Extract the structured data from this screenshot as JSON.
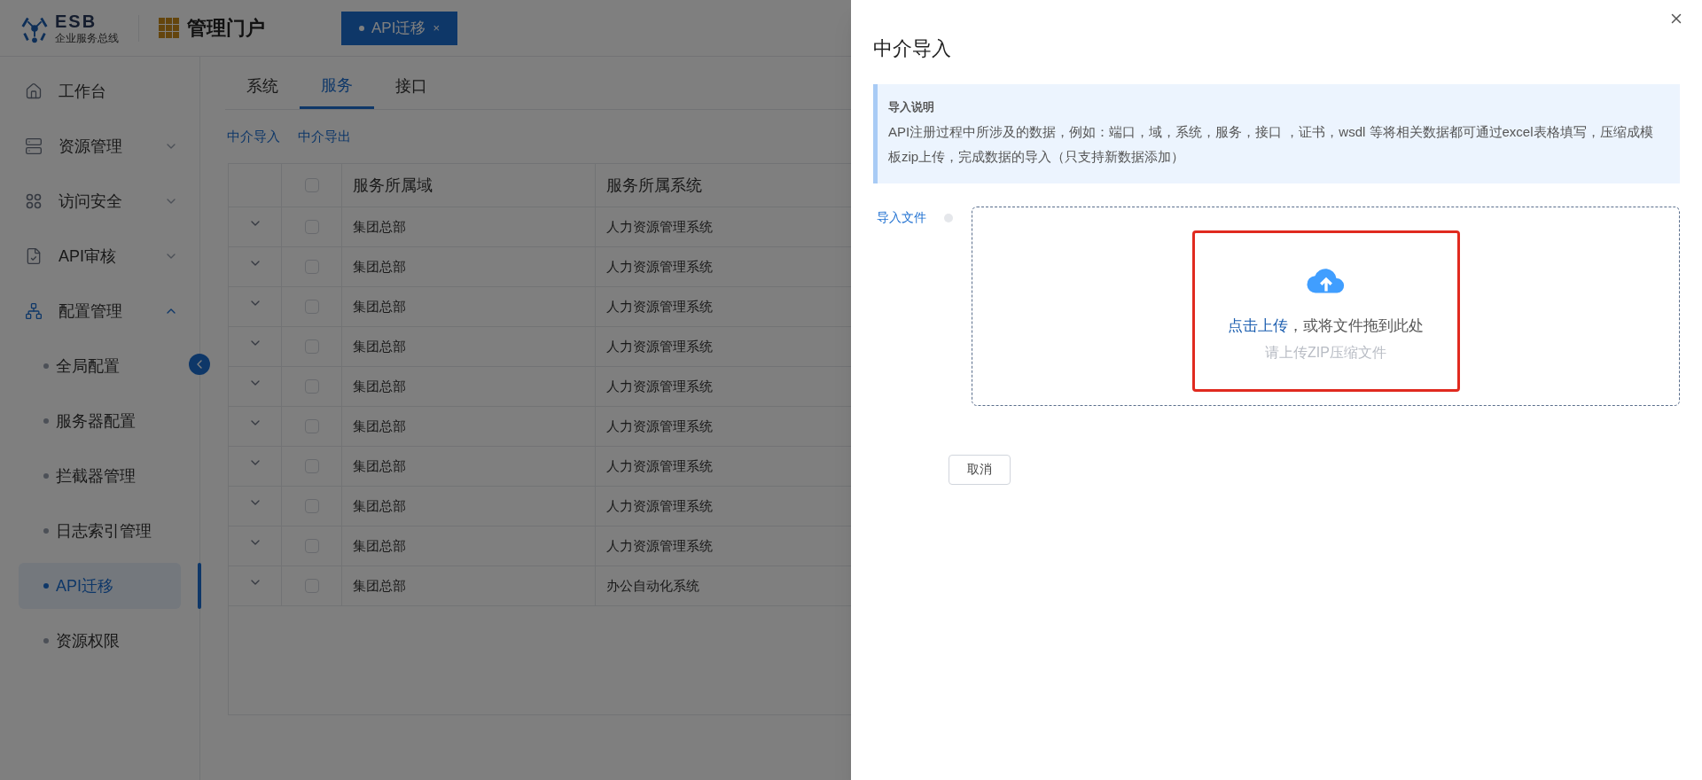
{
  "header": {
    "logo_title": "ESB",
    "logo_subtitle": "企业服务总线",
    "portal_title": "管理门户"
  },
  "open_tabs": [
    {
      "label": "API迁移",
      "close": "×",
      "selected": true
    }
  ],
  "sidebar": {
    "items": [
      {
        "label": "工作台",
        "selected": false
      },
      {
        "label": "资源管理",
        "expanded": false,
        "selected": false
      },
      {
        "label": "访问安全",
        "expanded": false,
        "selected": false
      },
      {
        "label": "API审核",
        "expanded": false,
        "selected": false
      },
      {
        "label": "配置管理",
        "expanded": true,
        "selected": false,
        "children": [
          {
            "label": "全局配置",
            "selected": false
          },
          {
            "label": "服务器配置",
            "selected": false
          },
          {
            "label": "拦截器管理",
            "selected": false
          },
          {
            "label": "日志索引管理",
            "selected": false
          },
          {
            "label": "API迁移",
            "selected": true
          },
          {
            "label": "资源权限",
            "selected": false
          }
        ]
      }
    ]
  },
  "tabs": [
    {
      "label": "系统",
      "selected": false
    },
    {
      "label": "服务",
      "selected": true
    },
    {
      "label": "接口",
      "selected": false
    }
  ],
  "actions": [
    "中介导入",
    "中介导出"
  ],
  "table": {
    "columns": [
      "服务所属域",
      "服务所属系统"
    ],
    "all_checked": false,
    "rows": [
      {
        "domain": "集团总部",
        "system": "人力资源管理系统",
        "checked": false
      },
      {
        "domain": "集团总部",
        "system": "人力资源管理系统",
        "checked": false
      },
      {
        "domain": "集团总部",
        "system": "人力资源管理系统",
        "checked": false
      },
      {
        "domain": "集团总部",
        "system": "人力资源管理系统",
        "checked": false
      },
      {
        "domain": "集团总部",
        "system": "人力资源管理系统",
        "checked": false
      },
      {
        "domain": "集团总部",
        "system": "人力资源管理系统",
        "checked": false
      },
      {
        "domain": "集团总部",
        "system": "人力资源管理系统",
        "checked": false
      },
      {
        "domain": "集团总部",
        "system": "人力资源管理系统",
        "checked": false
      },
      {
        "domain": "集团总部",
        "system": "人力资源管理系统",
        "checked": false
      },
      {
        "domain": "集团总部",
        "system": "办公自动化系统",
        "checked": false
      }
    ]
  },
  "drawer": {
    "title": "中介导入",
    "notice": {
      "title": "导入说明",
      "text": "API注册过程中所涉及的数据，例如：端口，域，系统，服务，接口 ，证书，wsdl 等将相关数据都可通过excel表格填写，压缩成模板zip上传，完成数据的导入（只支持新数据添加）"
    },
    "form_label": "导入文件",
    "upload": {
      "link": "点击上传",
      "text": "，或将文件拖到此处",
      "hint": "请上传ZIP压缩文件"
    },
    "cancel": "取消"
  }
}
